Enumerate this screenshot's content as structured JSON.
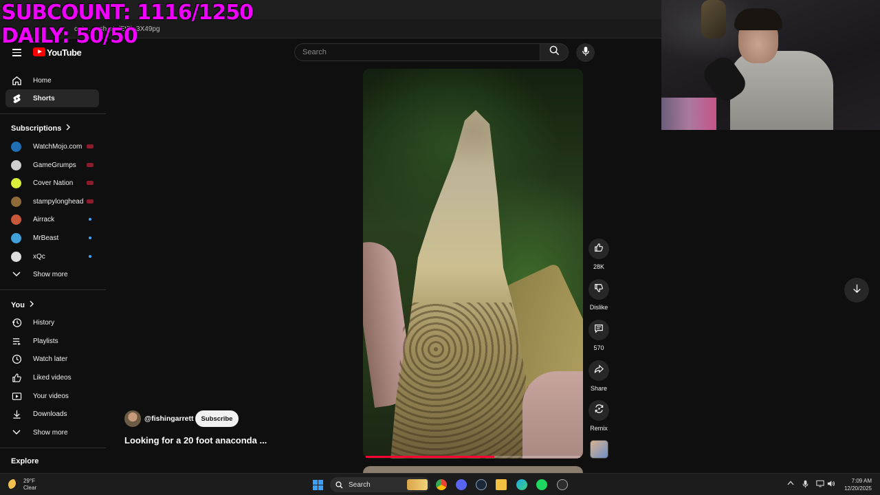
{
  "overlay": {
    "subcount": "SUBCOUNT: 1116/1250",
    "daily": "DAILY: 50/50"
  },
  "browser": {
    "url": "out…… shorts/Et5k-3X49pg"
  },
  "youtube": {
    "logo_text": "YouTube",
    "search_placeholder": "Search"
  },
  "sidebar": {
    "main": [
      {
        "label": "Home",
        "icon": "home-icon"
      },
      {
        "label": "Shorts",
        "icon": "shorts-icon",
        "active": true
      }
    ],
    "subscriptions_title": "Subscriptions",
    "subscriptions": [
      {
        "label": "WatchMojo.com",
        "status": "live",
        "avatar_color": "#1f6fb2"
      },
      {
        "label": "GameGrumps",
        "status": "live",
        "avatar_color": "#cfcfcf"
      },
      {
        "label": "Cover Nation",
        "status": "live",
        "avatar_color": "#d8f03a"
      },
      {
        "label": "stampylonghead",
        "status": "live",
        "avatar_color": "#8f6b3a"
      },
      {
        "label": "Airrack",
        "status": "new",
        "avatar_color": "#c9583b"
      },
      {
        "label": "MrBeast",
        "status": "new",
        "avatar_color": "#41a0d8"
      },
      {
        "label": "xQc",
        "status": "new",
        "avatar_color": "#dedede"
      }
    ],
    "show_more_1": "Show more",
    "you_title": "You",
    "you_items": [
      {
        "label": "History",
        "icon": "history-icon"
      },
      {
        "label": "Playlists",
        "icon": "playlists-icon"
      },
      {
        "label": "Watch later",
        "icon": "watch-later-icon"
      },
      {
        "label": "Liked videos",
        "icon": "thumbs-up-icon"
      },
      {
        "label": "Your videos",
        "icon": "your-videos-icon"
      },
      {
        "label": "Downloads",
        "icon": "download-icon"
      }
    ],
    "show_more_2": "Show more",
    "explore_title": "Explore"
  },
  "short": {
    "channel": "@fishingarrett",
    "subscribe_label": "Subscribe",
    "title": "Looking for a 20 foot anaconda ...",
    "progress_fraction": 0.6
  },
  "actions": {
    "likes": "28K",
    "dislike": "Dislike",
    "comments": "570",
    "share": "Share",
    "remix": "Remix"
  },
  "taskbar": {
    "temperature": "29°F",
    "condition": "Clear",
    "search_label": "Search",
    "time": "7:09 AM",
    "date": "12/20/2025"
  },
  "colors": {
    "accent_red": "#ff0000",
    "overlay_magenta": "#f000ff",
    "live_badge": "#8e1b2c",
    "new_dot": "#3ea6ff"
  }
}
